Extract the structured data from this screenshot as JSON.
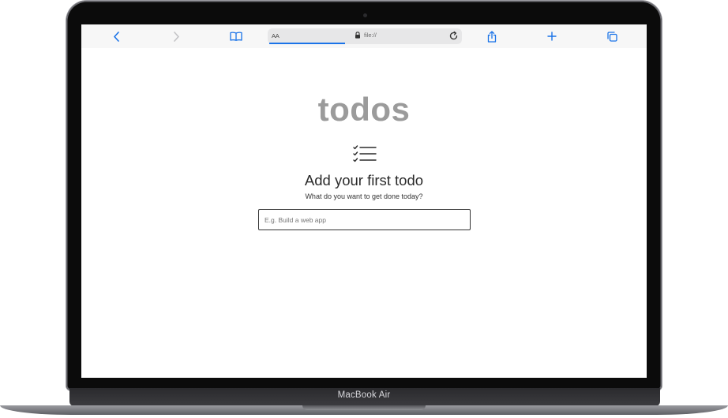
{
  "device": {
    "label": "MacBook Air"
  },
  "browser": {
    "toolbar": {
      "back_icon": "chevron-left-icon",
      "forward_icon": "chevron-right-icon",
      "bookmarks_icon": "book-icon",
      "share_icon": "share-icon",
      "new_tab_icon": "plus-icon",
      "tabs_icon": "tabs-icon"
    },
    "address_bar": {
      "text_size_label": "AA",
      "url": "file://",
      "secure_icon": "lock-icon",
      "reload_icon": "reload-icon"
    },
    "accent_color": "#1a73e8"
  },
  "app": {
    "title": "todos",
    "empty_state": {
      "icon": "checklist-icon",
      "heading": "Add your first todo",
      "subheading": "What do you want to get done today?"
    },
    "new_todo": {
      "placeholder": "E.g. Build a web app",
      "value": ""
    }
  }
}
